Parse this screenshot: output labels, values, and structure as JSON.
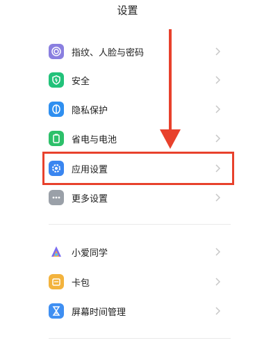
{
  "header": {
    "title": "设置"
  },
  "group1": {
    "items": [
      {
        "label": "指纹、人脸与密码",
        "icon": "fingerprint-icon",
        "color": "#8a7fe0"
      },
      {
        "label": "安全",
        "icon": "shield-icon",
        "color": "#22c27a"
      },
      {
        "label": "隐私保护",
        "icon": "privacy-icon",
        "color": "#2f8ff0"
      },
      {
        "label": "省电与电池",
        "icon": "battery-icon",
        "color": "#2dc06a"
      },
      {
        "label": "应用设置",
        "icon": "gear-icon",
        "color": "#3a86f0"
      },
      {
        "label": "更多设置",
        "icon": "more-icon",
        "color": "#9aa0a8"
      }
    ]
  },
  "group2": {
    "items": [
      {
        "label": "小爱同学",
        "icon": "xiaoai-icon",
        "color": "#7b6cf0"
      },
      {
        "label": "卡包",
        "icon": "wallet-icon",
        "color": "#f3b33d"
      },
      {
        "label": "屏幕时间管理",
        "icon": "hourglass-icon",
        "color": "#3f8ff2"
      }
    ]
  },
  "annotation": {
    "color": "#e8412c",
    "target": "应用设置"
  }
}
